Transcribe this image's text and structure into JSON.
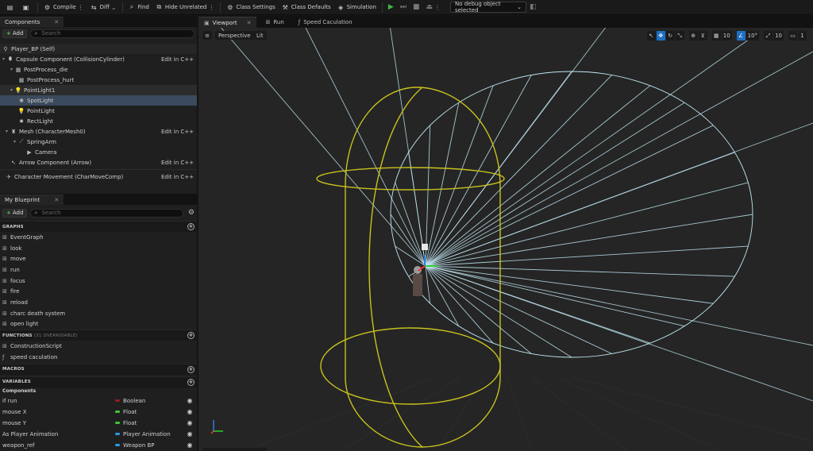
{
  "toolbar": {
    "compile": "Compile",
    "diff": "Diff",
    "find": "Find",
    "hide_unrelated": "Hide Unrelated",
    "class_settings": "Class Settings",
    "class_defaults": "Class Defaults",
    "simulation": "Simulation",
    "debug_object": "No debug object selected"
  },
  "components_panel": {
    "tab": "Components",
    "add": "Add",
    "search_placeholder": "Search",
    "rows": [
      {
        "label": "Player_BP (Self)",
        "edit": ""
      },
      {
        "label": "Capsule Component (CollisionCylinder)",
        "edit": "Edit in C++"
      },
      {
        "label": "PostProcess_die",
        "edit": ""
      },
      {
        "label": "PostProcess_hurt",
        "edit": ""
      },
      {
        "label": "PointLight1",
        "edit": ""
      },
      {
        "label": "SpotLight",
        "edit": ""
      },
      {
        "label": "PointLight",
        "edit": ""
      },
      {
        "label": "RectLight",
        "edit": ""
      },
      {
        "label": "Mesh (CharacterMesh0)",
        "edit": "Edit in C++"
      },
      {
        "label": "SpringArm",
        "edit": ""
      },
      {
        "label": "Camera",
        "edit": ""
      },
      {
        "label": "Arrow Component (Arrow)",
        "edit": "Edit in C++"
      },
      {
        "label": "Character Movement (CharMoveComp)",
        "edit": "Edit in C++"
      }
    ]
  },
  "blueprint_panel": {
    "tab": "My Blueprint",
    "add": "Add",
    "search_placeholder": "Search",
    "graphs_header": "GRAPHS",
    "graphs": [
      "EventGraph",
      "look",
      "move",
      "run",
      "focus",
      "fire",
      "reload",
      "charc death system",
      "open light"
    ],
    "functions_header": "FUNCTIONS",
    "functions_note": "(31 OVERRIDABLE)",
    "functions": [
      "ConstructionScript",
      "speed caculation"
    ],
    "macros_header": "MACROS",
    "variables_header": "VARIABLES",
    "components_subheader": "Components",
    "variables": [
      {
        "name": "if run",
        "type": "Boolean",
        "color": "#9b1b1b"
      },
      {
        "name": "mouse X",
        "type": "Float",
        "color": "#3cc83c"
      },
      {
        "name": "mouse Y",
        "type": "Float",
        "color": "#3cc83c"
      },
      {
        "name": "As Player Animation",
        "type": "Player Animation",
        "color": "#2b9ae8"
      },
      {
        "name": "weapon_ref",
        "type": "Weapon BP",
        "color": "#2b9ae8"
      }
    ]
  },
  "viewport": {
    "tabs": [
      "Viewport",
      "Run",
      "Speed Caculation"
    ],
    "perspective": "Perspective",
    "lit": "Lit",
    "grid_snap": "10",
    "rot_snap": "10°",
    "scale_snap": "10",
    "cam_speed": "1"
  },
  "colors": {
    "capsule": "#c8c21e",
    "light_cone": "#bfe6f2",
    "accent": "#1f6fc4"
  }
}
